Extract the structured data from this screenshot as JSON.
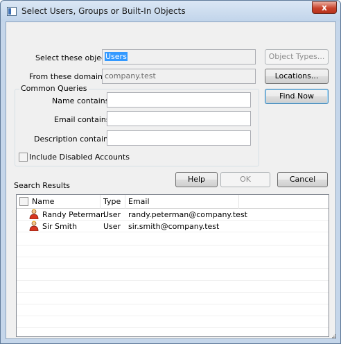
{
  "window": {
    "title": "Select Users, Groups or Built-In Objects",
    "close_glyph": "x"
  },
  "form": {
    "object_label": "Select these object",
    "object_value": "Users",
    "object_types_button": "Object Types...",
    "domains_label": "From these domains:",
    "domains_value": "company.test",
    "locations_button": "Locations...",
    "common_queries_label": "Common Queries",
    "name_label": "Name contains:",
    "name_value": "",
    "email_label": "Email contains:",
    "email_value": "",
    "description_label": "Description contains:",
    "description_value": "",
    "include_disabled_label": "Include Disabled Accounts",
    "include_disabled_checked": false,
    "find_now_button": "Find Now"
  },
  "actions": {
    "help_button": "Help",
    "ok_button": "OK",
    "cancel_button": "Cancel"
  },
  "results": {
    "label": "Search Results",
    "columns": [
      "Name",
      "Type",
      "Email"
    ],
    "rows": [
      {
        "name": "Randy Peterman",
        "type": "User",
        "email": "randy.peterman@company.test",
        "icon": "user-icon"
      },
      {
        "name": "Sir Smith",
        "type": "User",
        "email": "sir.smith@company.test",
        "icon": "user-icon"
      }
    ]
  },
  "colors": {
    "selection": "#3399ff",
    "close_button": "#c9432c",
    "frame": "#c5d6ea"
  }
}
